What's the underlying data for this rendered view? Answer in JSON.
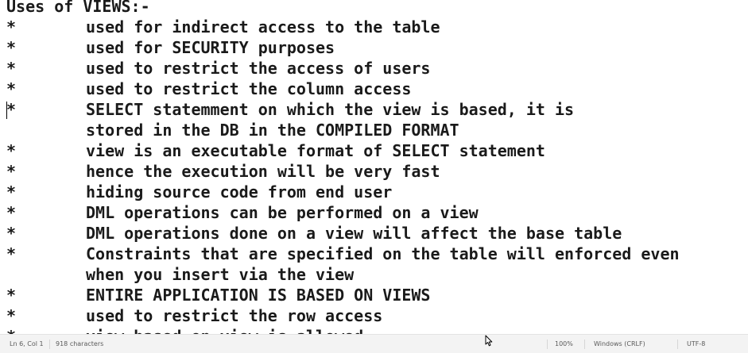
{
  "editor": {
    "lines": [
      {
        "bullet": "",
        "text": "Uses of VIEWS:-"
      },
      {
        "bullet": "*",
        "text": "used for indirect access to the table"
      },
      {
        "bullet": "*",
        "text": "used for SECURITY purposes"
      },
      {
        "bullet": "*",
        "text": "used to restrict the access of users"
      },
      {
        "bullet": "*",
        "text": "used to restrict the column access"
      },
      {
        "bullet": "*",
        "text": "SELECT statemment on which the view is based, it is"
      },
      {
        "bullet": "",
        "text": "stored in the DB in the COMPILED FORMAT"
      },
      {
        "bullet": "*",
        "text": "view is an executable format of SELECT statement"
      },
      {
        "bullet": "*",
        "text": "hence the execution will be very fast"
      },
      {
        "bullet": "*",
        "text": "hiding source code from end user"
      },
      {
        "bullet": "*",
        "text": "DML operations can be performed on a view"
      },
      {
        "bullet": "*",
        "text": "DML operations done on a view will affect the base table"
      },
      {
        "bullet": "*",
        "text": "Constraints that are specified on the table will enforced even"
      },
      {
        "bullet": "",
        "text": "when you insert via the view"
      },
      {
        "bullet": "*",
        "text": "ENTIRE APPLICATION IS BASED ON VIEWS"
      },
      {
        "bullet": "*",
        "text": "used to restrict the row access"
      },
      {
        "bullet": "*",
        "text": "view based on view is allowed"
      }
    ]
  },
  "status_bar": {
    "cursor_position": "Ln 6, Col 1",
    "character_count": "918 characters",
    "zoom": "100%",
    "line_ending": "Windows (CRLF)",
    "encoding": "UTF-8"
  }
}
